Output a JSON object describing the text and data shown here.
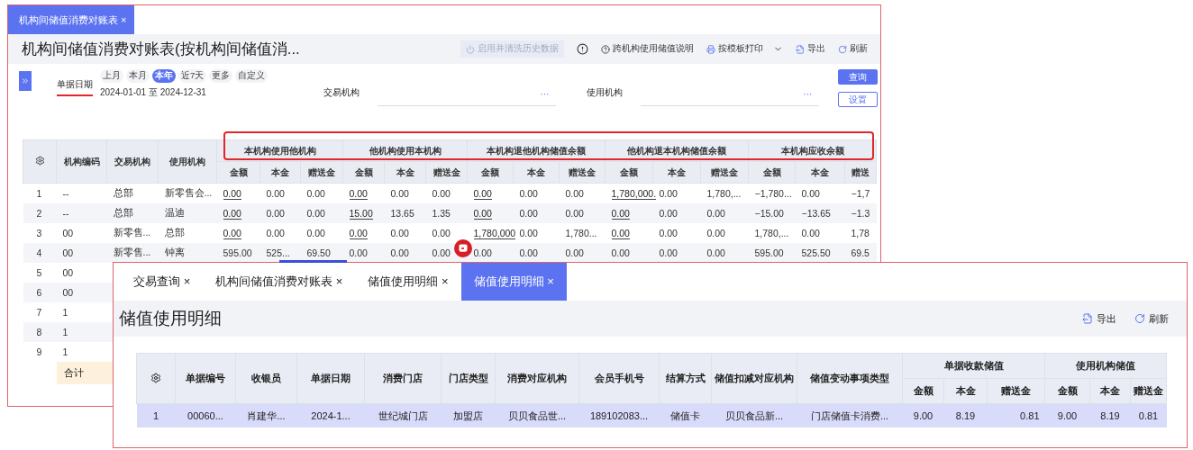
{
  "back_window": {
    "tab": {
      "label": "机构间储值消费对账表",
      "close": "×",
      "selected": true
    },
    "title": "机构间储值消费对账表(按机构间储值消...",
    "toolbar": [
      {
        "kind": "toggle",
        "label": "启用并清洗历史数据",
        "disabled": true
      },
      {
        "kind": "info",
        "disabled": false
      },
      {
        "kind": "help",
        "label": "跨机构使用储值说明",
        "disabled": false
      },
      {
        "kind": "print",
        "label": "按模板打印",
        "disabled": false
      },
      {
        "kind": "export",
        "label": "导出",
        "disabled": false
      },
      {
        "kind": "refresh",
        "label": "刷新",
        "disabled": false
      }
    ],
    "filters": {
      "date_label": "单据日期",
      "presets": [
        {
          "label": "上月",
          "selected": false
        },
        {
          "label": "本月",
          "selected": false
        },
        {
          "label": "本年",
          "selected": true
        },
        {
          "label": "近7天",
          "selected": false
        },
        {
          "label": "更多",
          "selected": false
        },
        {
          "label": "自定义",
          "selected": false
        }
      ],
      "date_range": "2024-01-01 至 2024-12-31",
      "fields": [
        {
          "label": "交易机构",
          "more": "···"
        },
        {
          "label": "使用机构",
          "more": "···"
        }
      ],
      "buttons": [
        {
          "label": "查询",
          "primary": true
        },
        {
          "label": "设置",
          "primary": false
        }
      ]
    },
    "table": {
      "columns": [
        "",
        "机构编码",
        "交易机构",
        "使用机构"
      ],
      "groups": [
        {
          "title": "本机构使用他机构",
          "columns": [
            "金额",
            "本金",
            "赠送金"
          ]
        },
        {
          "title": "他机构使用本机构",
          "columns": [
            "金额",
            "本金",
            "赠送金"
          ]
        },
        {
          "title": "本机构退他机构储值余额",
          "columns": [
            "金额",
            "本金",
            "赠送金"
          ]
        },
        {
          "title": "他机构退本机构储值余额",
          "columns": [
            "金额",
            "本金",
            "赠送金"
          ]
        },
        {
          "title": "本机构应收余额",
          "columns": [
            "金额",
            "本金",
            "赠送"
          ]
        }
      ],
      "rows": [
        {
          "index": "1",
          "code": "--",
          "trade_org": "总部",
          "use_org": "新零售会...",
          "values": [
            {
              "text": "0.00",
              "link": true
            },
            {
              "text": "0.00",
              "link": false
            },
            {
              "text": "0.00",
              "link": false
            },
            {
              "text": "0.00",
              "link": true
            },
            {
              "text": "0.00",
              "link": false
            },
            {
              "text": "0.00",
              "link": false
            },
            {
              "text": "0.00",
              "link": true
            },
            {
              "text": "0.00",
              "link": false
            },
            {
              "text": "0.00",
              "link": false
            },
            {
              "text": "1,780,000.",
              "link": true
            },
            {
              "text": "0.00",
              "link": false
            },
            {
              "text": "1,780,...",
              "link": false
            },
            {
              "text": "−1,780...",
              "link": false
            },
            {
              "text": "0.00",
              "link": false
            },
            {
              "text": "−1,7",
              "link": false
            }
          ]
        },
        {
          "index": "2",
          "code": "--",
          "trade_org": "总部",
          "use_org": "温迪",
          "values": [
            {
              "text": "0.00",
              "link": true
            },
            {
              "text": "0.00",
              "link": false
            },
            {
              "text": "0.00",
              "link": false
            },
            {
              "text": "15.00",
              "link": true
            },
            {
              "text": "13.65",
              "link": false
            },
            {
              "text": "1.35",
              "link": false
            },
            {
              "text": "0.00",
              "link": true
            },
            {
              "text": "0.00",
              "link": false
            },
            {
              "text": "0.00",
              "link": false
            },
            {
              "text": "0.00",
              "link": true
            },
            {
              "text": "0.00",
              "link": false
            },
            {
              "text": "0.00",
              "link": false
            },
            {
              "text": "−15.00",
              "link": false
            },
            {
              "text": "−13.65",
              "link": false
            },
            {
              "text": "−1.3",
              "link": false
            }
          ]
        },
        {
          "index": "3",
          "code": "00",
          "trade_org": "新零售...",
          "use_org": "总部",
          "values": [
            {
              "text": "0.00",
              "link": true
            },
            {
              "text": "0.00",
              "link": false
            },
            {
              "text": "0.00",
              "link": false
            },
            {
              "text": "0.00",
              "link": true
            },
            {
              "text": "0.00",
              "link": false
            },
            {
              "text": "0.00",
              "link": false
            },
            {
              "text": "1,780,000",
              "link": true
            },
            {
              "text": "0.00",
              "link": false
            },
            {
              "text": "1,780...",
              "link": false
            },
            {
              "text": "0.00",
              "link": true
            },
            {
              "text": "0.00",
              "link": false
            },
            {
              "text": "0.00",
              "link": false
            },
            {
              "text": "1,780,...",
              "link": false
            },
            {
              "text": "0.00",
              "link": false
            },
            {
              "text": "1,78",
              "link": false
            }
          ]
        },
        {
          "index": "4",
          "code": "00",
          "trade_org": "新零售...",
          "use_org": "钟离",
          "values": [
            {
              "text": "595.00",
              "link": false
            },
            {
              "text": "525...",
              "link": false
            },
            {
              "text": "69.50",
              "link": false
            },
            {
              "text": "0.00",
              "link": false
            },
            {
              "text": "0.00",
              "link": false
            },
            {
              "text": "0.00",
              "link": false
            },
            {
              "text": "0.00",
              "link": false
            },
            {
              "text": "0.00",
              "link": false
            },
            {
              "text": "0.00",
              "link": false
            },
            {
              "text": "0.00",
              "link": false
            },
            {
              "text": "0.00",
              "link": false
            },
            {
              "text": "0.00",
              "link": false
            },
            {
              "text": "595.00",
              "link": false
            },
            {
              "text": "525.50",
              "link": false
            },
            {
              "text": "69.5",
              "link": false
            }
          ]
        },
        {
          "index": "5",
          "code": "00"
        },
        {
          "index": "6",
          "code": "00"
        },
        {
          "index": "7",
          "code": "1"
        },
        {
          "index": "8",
          "code": "1"
        },
        {
          "index": "9",
          "code": "1"
        }
      ],
      "summary_label": "合计"
    }
  },
  "overlay_window": {
    "tabs": [
      {
        "label": "交易查询",
        "close": "×",
        "selected": false
      },
      {
        "label": "机构间储值消费对账表",
        "close": "×",
        "selected": false
      },
      {
        "label": "储值使用明细",
        "close": "×",
        "selected": false
      },
      {
        "label": "储值使用明细",
        "close": "×",
        "selected": true
      }
    ],
    "title": "储值使用明细",
    "actions": [
      {
        "kind": "export",
        "label": "导出"
      },
      {
        "kind": "refresh",
        "label": "刷新"
      }
    ],
    "table": {
      "columns": [
        "",
        "单据编号",
        "收银员",
        "单据日期",
        "消费门店",
        "门店类型",
        "消费对应机构",
        "会员手机号",
        "结算方式",
        "储值扣减对应机构",
        "储值变动事项类型"
      ],
      "groups": [
        {
          "title": "单据收款储值",
          "columns": [
            "金额",
            "本金",
            "赠送金"
          ]
        },
        {
          "title": "使用机构储值",
          "columns": [
            "金额",
            "本金",
            "赠送金"
          ]
        }
      ],
      "rows": [
        {
          "selected": true,
          "cells": [
            "1",
            "00060...",
            "肖建华...",
            "2024-1...",
            "世纪城门店",
            "加盟店",
            "贝贝食品世...",
            "189102083...",
            "储值卡",
            "贝贝食品新...",
            "门店储值卡消费...",
            "9.00",
            "8.19",
            "0.81",
            "9.00",
            "8.19",
            "0.81"
          ]
        }
      ]
    }
  }
}
